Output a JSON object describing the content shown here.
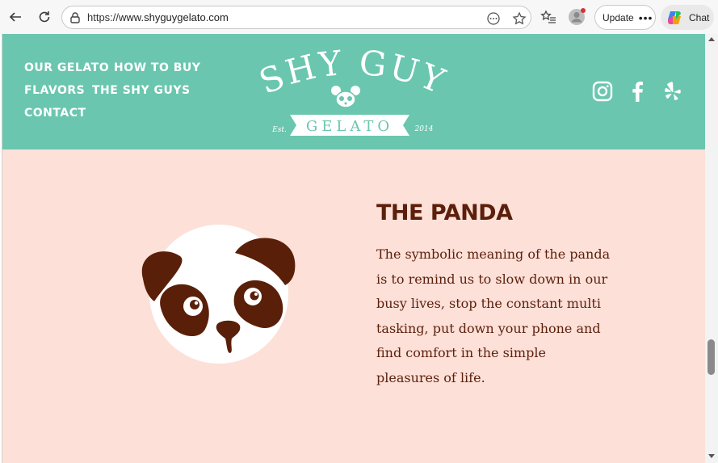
{
  "browser": {
    "url_scheme": "https://",
    "url_host": "www.shyguygelato.com",
    "update_label": "Update",
    "update_dots": "•••",
    "chat_label": "Chat"
  },
  "site": {
    "menu": [
      {
        "label": "OUR GELATO"
      },
      {
        "label": "HOW TO BUY"
      },
      {
        "label": "FLAVORS"
      },
      {
        "label": "THE SHY GUYS"
      },
      {
        "label": "CONTACT"
      }
    ],
    "logo": {
      "line1": "SHY GUY",
      "line2": "GELATO",
      "est": "Est.",
      "year": "2014"
    },
    "social_icons": [
      "instagram-icon",
      "facebook-icon",
      "yelp-icon"
    ]
  },
  "section": {
    "title": "THE PANDA",
    "body": "The symbolic meaning of the panda is to remind us to slow down in our busy lives, stop the constant multi tasking, put down your phone and find comfort in the simple pleasures of life."
  },
  "colors": {
    "header_bg": "#6ac6af",
    "page_bg": "#fde0d8",
    "text_brown": "#5b1f0b"
  }
}
